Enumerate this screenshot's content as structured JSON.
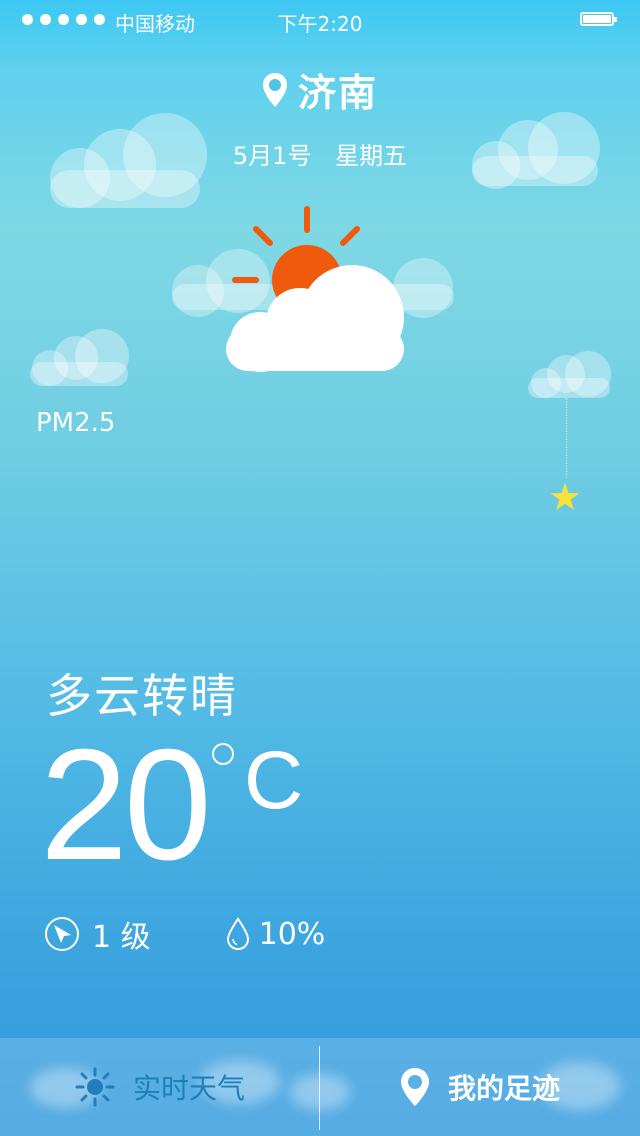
{
  "status_bar": {
    "carrier": "中国移动",
    "time": "下午2:20",
    "signal_bars": 5,
    "battery_level": 1.0
  },
  "location": {
    "city": "济南",
    "icon": "location-pin-icon"
  },
  "date": {
    "day": "5月1号",
    "weekday": "星期五"
  },
  "weather": {
    "icon": "partly-cloudy-icon",
    "condition": "多云转晴",
    "temperature": "20",
    "unit": "C",
    "wind_level": "1 级",
    "humidity": "10%",
    "pm_label": "PM2.5"
  },
  "tabs": [
    {
      "label": "实时天气",
      "icon": "sun-icon",
      "active": false
    },
    {
      "label": "我的足迹",
      "icon": "location-pin-icon",
      "active": true
    }
  ],
  "colors": {
    "sun": "#ef5a0c",
    "star": "#f9e13a",
    "inactive_tab": "#1f7fb8"
  }
}
